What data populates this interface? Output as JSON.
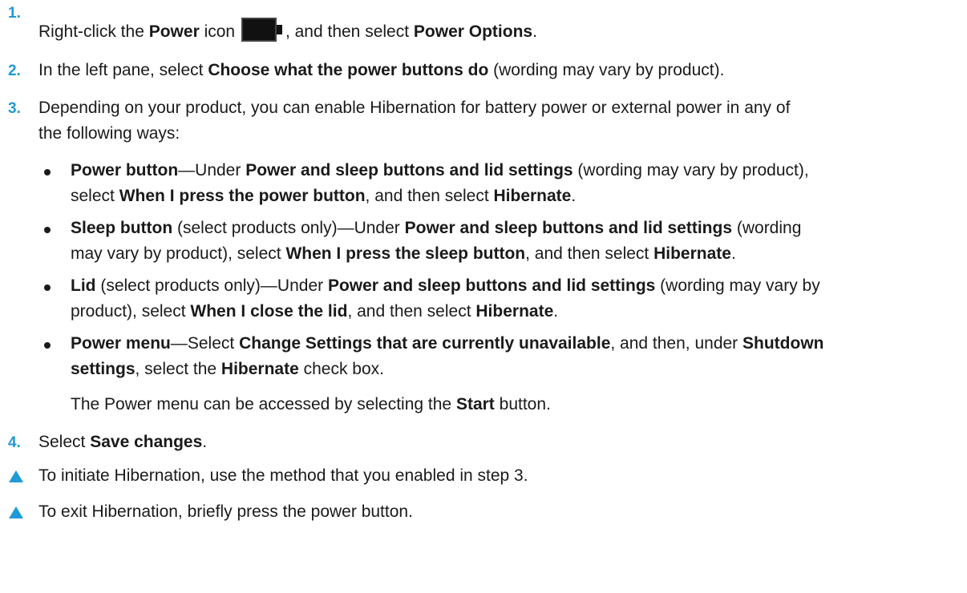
{
  "steps": [
    {
      "number": "1.",
      "before_icon": [
        {
          "t": "Right-click the "
        },
        {
          "t": "Power",
          "b": true
        },
        {
          "t": " icon "
        }
      ],
      "icon": "battery-icon",
      "after_icon": [
        {
          "t": ", and then select "
        },
        {
          "t": "Power Options",
          "b": true
        },
        {
          "t": "."
        }
      ]
    },
    {
      "number": "2.",
      "lines": [
        [
          {
            "t": "In the left pane, select "
          },
          {
            "t": "Choose what the power buttons do",
            "b": true
          },
          {
            "t": " (wording may vary by product)."
          }
        ]
      ]
    },
    {
      "number": "3.",
      "lines": [
        [
          {
            "t": "Depending on your product, you can enable Hibernation for battery power or external power in any of"
          }
        ],
        [
          {
            "t": "the following ways:"
          }
        ]
      ]
    }
  ],
  "bullets": [
    {
      "lines": [
        [
          {
            "t": "Power button",
            "b": true
          },
          {
            "t": "—Under "
          },
          {
            "t": "Power and sleep buttons and lid settings",
            "b": true
          },
          {
            "t": " (wording may vary by product),"
          }
        ],
        [
          {
            "t": "select "
          },
          {
            "t": "When I press the power button",
            "b": true
          },
          {
            "t": ", and then select "
          },
          {
            "t": "Hibernate",
            "b": true
          },
          {
            "t": "."
          }
        ]
      ]
    },
    {
      "lines": [
        [
          {
            "t": "Sleep button",
            "b": true
          },
          {
            "t": " (select products only)—Under "
          },
          {
            "t": "Power and sleep buttons and lid settings",
            "b": true
          },
          {
            "t": " (wording"
          }
        ],
        [
          {
            "t": "may vary by product), select "
          },
          {
            "t": "When I press the sleep button",
            "b": true
          },
          {
            "t": ", and then select "
          },
          {
            "t": "Hibernate",
            "b": true
          },
          {
            "t": "."
          }
        ]
      ]
    },
    {
      "lines": [
        [
          {
            "t": "Lid",
            "b": true
          },
          {
            "t": " (select products only)—Under "
          },
          {
            "t": "Power and sleep buttons and lid settings",
            "b": true
          },
          {
            "t": " (wording may vary by"
          }
        ],
        [
          {
            "t": "product), select "
          },
          {
            "t": "When I close the lid",
            "b": true
          },
          {
            "t": ", and then select "
          },
          {
            "t": "Hibernate",
            "b": true
          },
          {
            "t": "."
          }
        ]
      ]
    },
    {
      "lines": [
        [
          {
            "t": "Power menu",
            "b": true
          },
          {
            "t": "—Select "
          },
          {
            "t": "Change Settings that are currently unavailable",
            "b": true
          },
          {
            "t": ", and then, under "
          },
          {
            "t": "Shutdown",
            "b": true
          }
        ],
        [
          {
            "t": "settings",
            "b": true
          },
          {
            "t": ", select the "
          },
          {
            "t": "Hibernate",
            "b": true
          },
          {
            "t": " check box."
          }
        ]
      ]
    }
  ],
  "bullet_note": [
    {
      "t": "The Power menu can be accessed by selecting the "
    },
    {
      "t": "Start",
      "b": true
    },
    {
      "t": " button."
    }
  ],
  "step4": {
    "number": "4.",
    "segs": [
      {
        "t": "Select "
      },
      {
        "t": "Save changes",
        "b": true
      },
      {
        "t": "."
      }
    ]
  },
  "notes": [
    {
      "text": "To initiate Hibernation, use the method that you enabled in step 3."
    },
    {
      "text": "To exit Hibernation, briefly press the power button."
    }
  ],
  "colors": {
    "accent": "#1f9ad6",
    "text": "#1a1a1a"
  }
}
